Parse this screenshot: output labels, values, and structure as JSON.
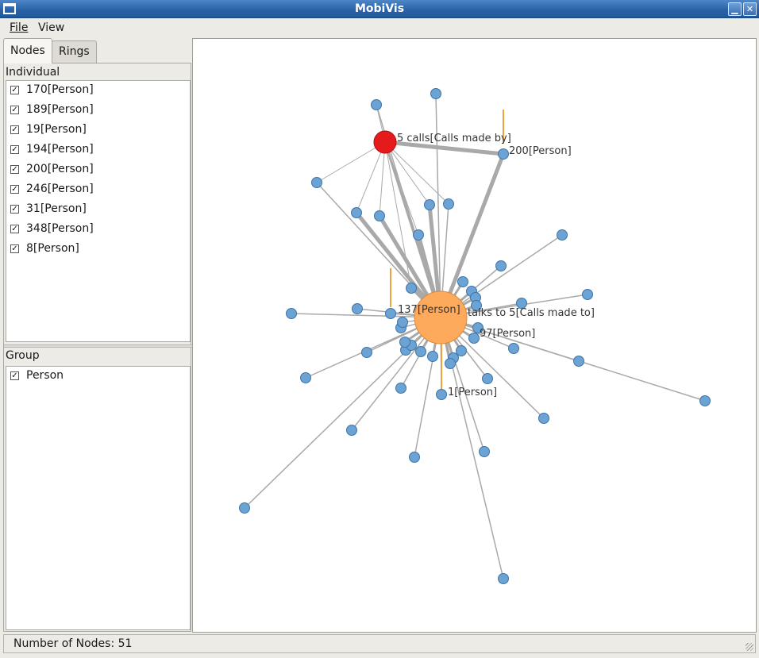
{
  "window": {
    "title": "MobiVis",
    "minimize_label": "▁",
    "close_label": "✕"
  },
  "menu": {
    "file_label": "File",
    "view_label": "View"
  },
  "tabs": {
    "nodes_label": "Nodes",
    "rings_label": "Rings"
  },
  "individual": {
    "label": "Individual",
    "items": [
      {
        "label": "170[Person]",
        "checked": true
      },
      {
        "label": "189[Person]",
        "checked": true
      },
      {
        "label": "19[Person]",
        "checked": true
      },
      {
        "label": "194[Person]",
        "checked": true
      },
      {
        "label": "200[Person]",
        "checked": true
      },
      {
        "label": "246[Person]",
        "checked": true
      },
      {
        "label": "31[Person]",
        "checked": true
      },
      {
        "label": "348[Person]",
        "checked": true
      },
      {
        "label": "8[Person]",
        "checked": true
      }
    ]
  },
  "group": {
    "label": "Group",
    "items": [
      {
        "label": "Person",
        "checked": true
      }
    ]
  },
  "graph": {
    "labels": {
      "calls": "5 calls[Calls made by]",
      "p200": "200[Person]",
      "center": "137[Person]",
      "talks": "talks to 5[Calls made to]",
      "p97": "97[Person]",
      "p1": "1[Person]"
    },
    "colors": {
      "node": "#6aa3d4",
      "node_stroke": "#3f74a8",
      "center_node": "#fdaa5c",
      "event_node": "#e41a1c",
      "edge": "#a9a9a9",
      "marker": "#f0a040"
    }
  },
  "status": {
    "text": "Number of Nodes: 51"
  }
}
